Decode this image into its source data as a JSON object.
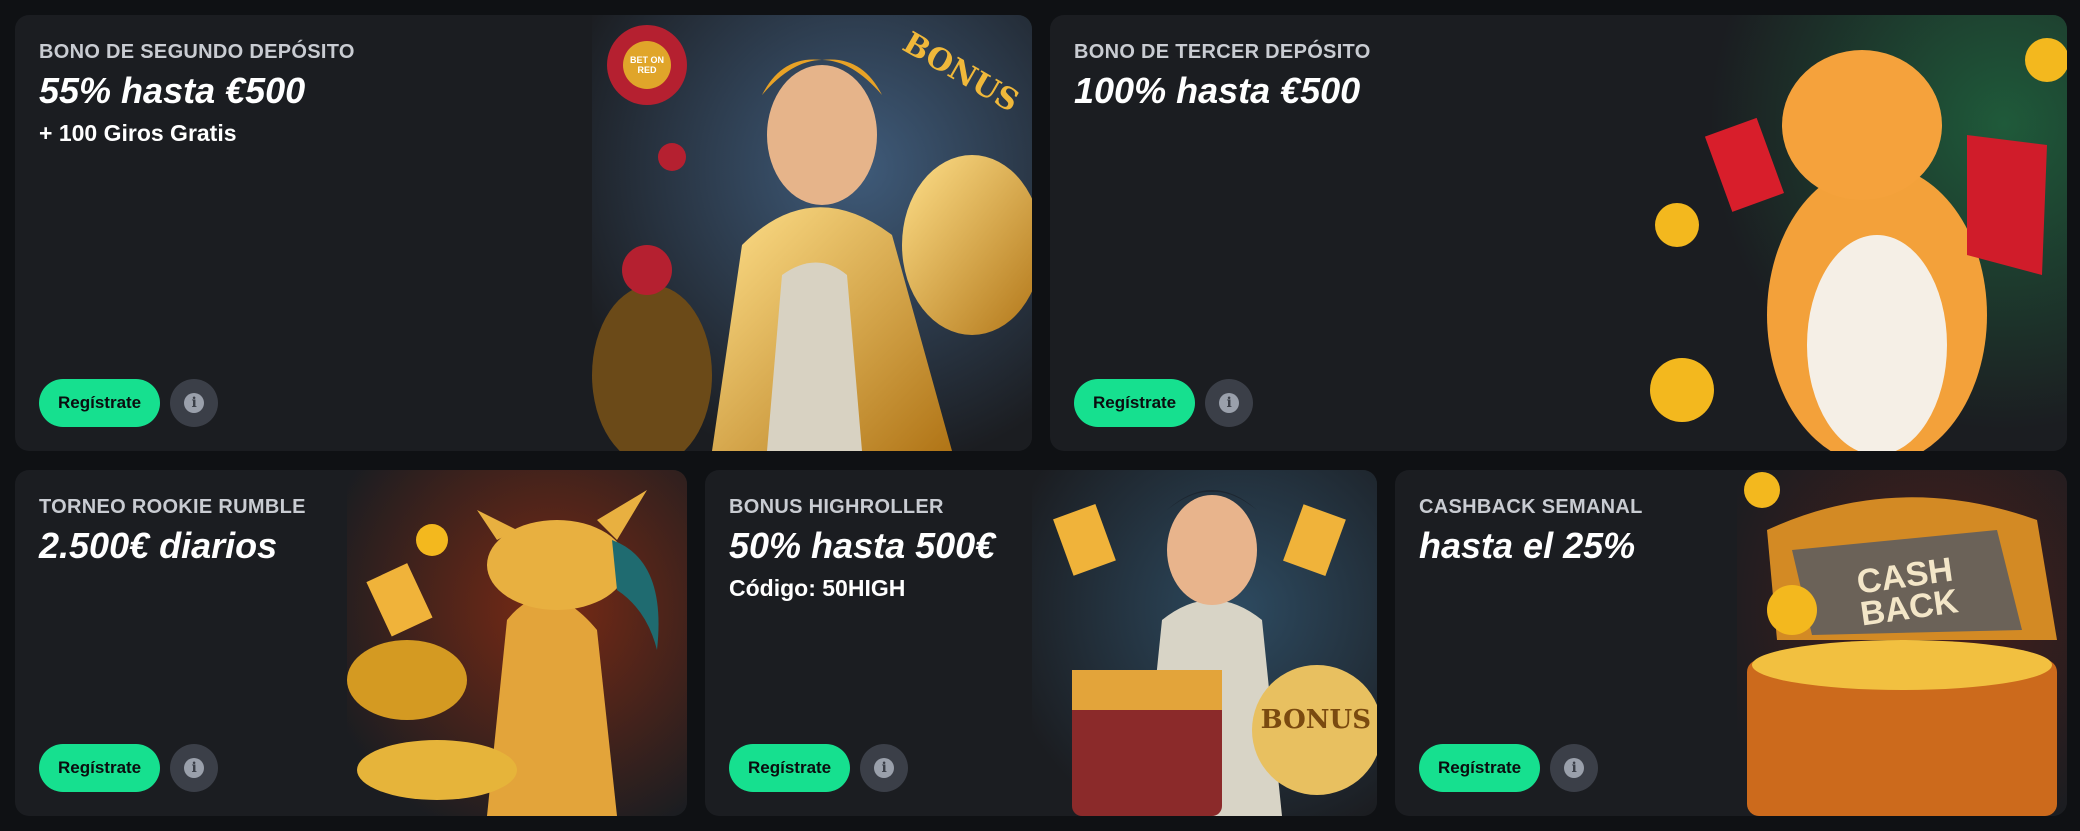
{
  "cards": [
    {
      "subtitle": "BONO DE SEGUNDO DEPÓSITO",
      "title": "55% hasta €500",
      "extra": "+ 100 Giros Gratis",
      "button": "Regístrate",
      "art": "knight-hero-illustration"
    },
    {
      "subtitle": "BONO DE TERCER DEPÓSITO",
      "title": "100% hasta €500",
      "button": "Regístrate",
      "art": "tiger-illustration"
    },
    {
      "subtitle": "TORNEO ROOKIE RUMBLE",
      "title": "2.500€ diarios",
      "button": "Regístrate",
      "art": "dragon-illustration"
    },
    {
      "subtitle": "BONUS HIGHROLLER",
      "title": "50% hasta 500€",
      "extra": "Código: 50HIGH",
      "button": "Regístrate",
      "art": "hero-treasure-illustration"
    },
    {
      "subtitle": "CASHBACK SEMANAL",
      "title": "hasta el 25%",
      "button": "Regístrate",
      "art": "cashback-chest-illustration"
    }
  ],
  "art_text": {
    "chip": "BET ON RED",
    "bonus": "BONUS",
    "cashback": "CASH BACK"
  },
  "colors": {
    "accent": "#16e08f",
    "card_bg": "#1b1d21",
    "page_bg": "#0f1114"
  }
}
